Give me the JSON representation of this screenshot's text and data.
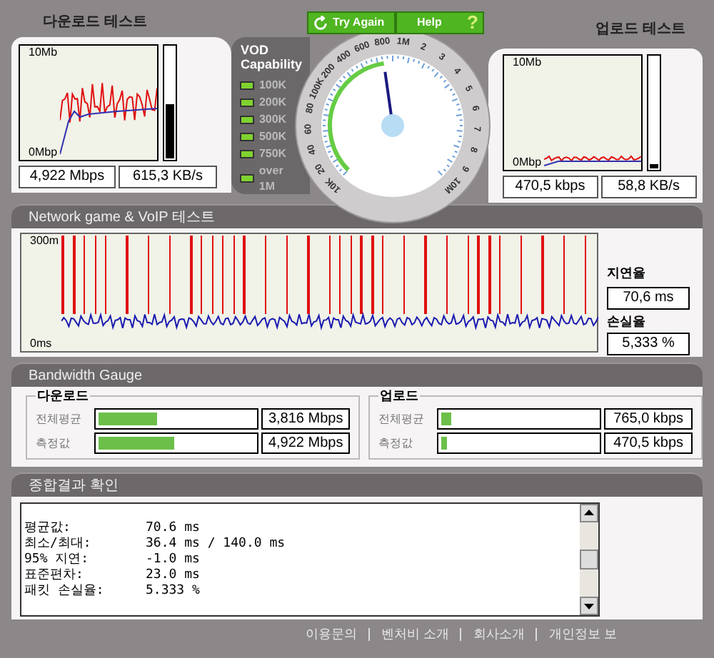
{
  "download": {
    "title": "다운로드 테스트",
    "chart_top": "10Mb",
    "chart_bottom": "0Mbp",
    "level": 0.48,
    "rate": "4,922 Mbps",
    "bytes": "615,3 KB/s"
  },
  "vod": {
    "title": "VOD Capability",
    "items": [
      {
        "label": "100K",
        "on": true
      },
      {
        "label": "200K",
        "on": true
      },
      {
        "label": "300K",
        "on": true
      },
      {
        "label": "500K",
        "on": true
      },
      {
        "label": "750K",
        "on": true
      },
      {
        "label": "over 1M",
        "on": true
      }
    ]
  },
  "buttons": {
    "retry": "Try Again",
    "help": "Help",
    "help_icon": "?"
  },
  "dial": {
    "level": 0.47,
    "labels": [
      "10K",
      "20",
      "40",
      "60",
      "80",
      "100K",
      "200",
      "400",
      "600",
      "800",
      "1M",
      "2",
      "3",
      "4",
      "5",
      "6",
      "7",
      "8",
      "9",
      "10M"
    ]
  },
  "upload": {
    "title": "업로드 테스트",
    "chart_top": "10Mb",
    "chart_bottom": "0Mbp",
    "level": 0.04,
    "rate": "470,5 kbps",
    "bytes": "58,8 KB/s"
  },
  "network": {
    "title": "Network game & VoIP 테스트",
    "chart_top": "300m",
    "chart_bottom": "0ms",
    "latency_label": "지연율",
    "latency": "70,6 ms",
    "loss_label": "손실율",
    "loss": "5,333 %"
  },
  "bandwidth": {
    "title": "Bandwidth Gauge",
    "groups": [
      {
        "title": "다운로드",
        "rows": [
          {
            "label": "전체평균",
            "level": 0.37,
            "value": "3,816 Mbps"
          },
          {
            "label": "측정값",
            "level": 0.48,
            "value": "4,922 Mbps"
          }
        ]
      },
      {
        "title": "업로드",
        "rows": [
          {
            "label": "전체평균",
            "level": 0.06,
            "value": "765,0 kbps"
          },
          {
            "label": "측정값",
            "level": 0.03,
            "value": "470,5 kbps"
          }
        ]
      }
    ]
  },
  "summary": {
    "title": "종합결과 확인",
    "lines": [
      {
        "label": "평균값:",
        "value": "70.6 ms"
      },
      {
        "label": "최소/최대:",
        "value": "36.4 ms / 140.0 ms"
      },
      {
        "label": "95% 지연:",
        "value": "-1.0 ms"
      },
      {
        "label": "표준편차:",
        "value": "23.0 ms"
      },
      {
        "label": "패킷 손실율:",
        "value": "5.333 %"
      }
    ]
  },
  "footer": {
    "links": [
      "이용문의",
      "벤처비 소개",
      "회사소개",
      "개인정보 보"
    ]
  }
}
